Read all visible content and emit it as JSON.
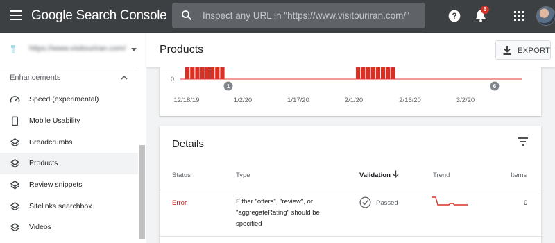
{
  "app": {
    "title": "Google Search Console",
    "search_placeholder": "Inspect any URL in \"https://www.visitouriran.com/\"",
    "notification_count": "6"
  },
  "sidebar": {
    "property": "https://www.visitouriran.com/",
    "section": "Enhancements",
    "items": [
      {
        "label": "Speed (experimental)",
        "icon": "speedometer-icon",
        "active": false
      },
      {
        "label": "Mobile Usability",
        "icon": "smartphone-icon",
        "active": false
      },
      {
        "label": "Breadcrumbs",
        "icon": "layers-icon",
        "active": false
      },
      {
        "label": "Products",
        "icon": "layers-icon",
        "active": true
      },
      {
        "label": "Review snippets",
        "icon": "layers-icon",
        "active": false
      },
      {
        "label": "Sitelinks searchbox",
        "icon": "layers-icon",
        "active": false
      },
      {
        "label": "Videos",
        "icon": "layers-icon",
        "active": false
      }
    ]
  },
  "header": {
    "title": "Products",
    "export_label": "EXPORT"
  },
  "chart_data": {
    "type": "bar",
    "y_tick": "0",
    "x_ticks": [
      "12/18/19",
      "1/2/20",
      "1/17/20",
      "2/1/20",
      "2/16/20",
      "3/2/20"
    ],
    "annotations": [
      "1",
      "6"
    ],
    "error_color": "#d93025"
  },
  "details": {
    "title": "Details",
    "columns": [
      "Status",
      "Type",
      "Validation",
      "Trend",
      "Items"
    ],
    "rows": [
      {
        "status": "Error",
        "type": "Either \"offers\", \"review\", or \"aggregateRating\" should be specified",
        "validation": "Passed",
        "items": "0"
      }
    ]
  }
}
